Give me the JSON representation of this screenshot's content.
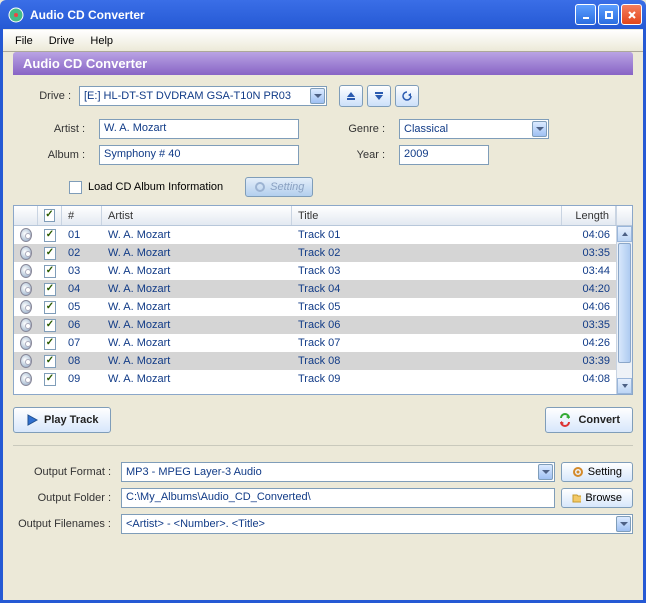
{
  "window": {
    "title": "Audio CD Converter"
  },
  "menu": {
    "file": "File",
    "drive": "Drive",
    "help": "Help"
  },
  "section": {
    "title": "Audio CD Converter"
  },
  "drive": {
    "label": "Drive :",
    "value": "[E:] HL-DT-ST DVDRAM GSA-T10N  PR03"
  },
  "meta": {
    "artist_label": "Artist :",
    "artist": "W. A. Mozart",
    "album_label": "Album :",
    "album": "Symphony # 40",
    "genre_label": "Genre :",
    "genre": "Classical",
    "year_label": "Year :",
    "year": "2009",
    "load_label": "Load CD Album Information",
    "setting_btn": "Setting"
  },
  "table": {
    "headers": {
      "num": "#",
      "artist": "Artist",
      "title": "Title",
      "length": "Length"
    },
    "rows": [
      {
        "num": "01",
        "artist": "W. A. Mozart",
        "title": "Track 01",
        "length": "04:06",
        "checked": true
      },
      {
        "num": "02",
        "artist": "W. A. Mozart",
        "title": "Track 02",
        "length": "03:35",
        "checked": true
      },
      {
        "num": "03",
        "artist": "W. A. Mozart",
        "title": "Track 03",
        "length": "03:44",
        "checked": true
      },
      {
        "num": "04",
        "artist": "W. A. Mozart",
        "title": "Track 04",
        "length": "04:20",
        "checked": true
      },
      {
        "num": "05",
        "artist": "W. A. Mozart",
        "title": "Track 05",
        "length": "04:06",
        "checked": true
      },
      {
        "num": "06",
        "artist": "W. A. Mozart",
        "title": "Track 06",
        "length": "03:35",
        "checked": true
      },
      {
        "num": "07",
        "artist": "W. A. Mozart",
        "title": "Track 07",
        "length": "04:26",
        "checked": true
      },
      {
        "num": "08",
        "artist": "W. A. Mozart",
        "title": "Track 08",
        "length": "03:39",
        "checked": true
      },
      {
        "num": "09",
        "artist": "W. A. Mozart",
        "title": "Track 09",
        "length": "04:08",
        "checked": true
      }
    ]
  },
  "actions": {
    "play": "Play Track",
    "convert": "Convert"
  },
  "output": {
    "format_label": "Output Format :",
    "format": "MP3 - MPEG Layer-3 Audio",
    "folder_label": "Output Folder :",
    "folder": "C:\\My_Albums\\Audio_CD_Converted\\",
    "filenames_label": "Output Filenames :",
    "filenames": "<Artist> - <Number>. <Title>",
    "setting_btn": "Setting",
    "browse_btn": "Browse"
  }
}
